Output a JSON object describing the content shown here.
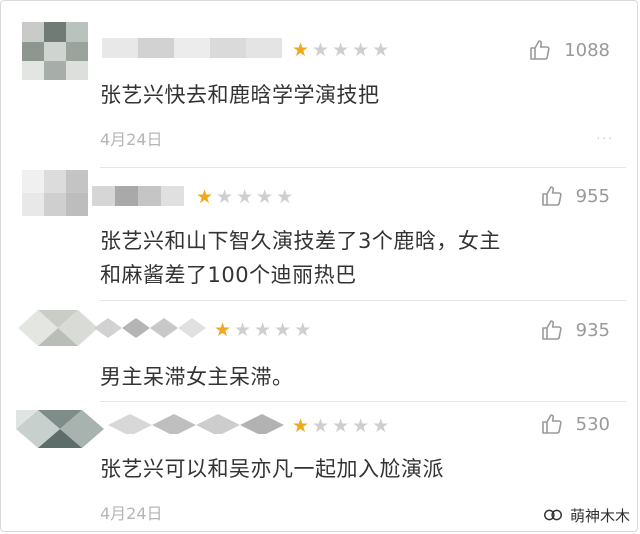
{
  "comments": [
    {
      "rating": 1,
      "likes": "1088",
      "text_lines": [
        "张艺兴快去和鹿晗学学演技把"
      ],
      "date": "4月24日"
    },
    {
      "rating": 1,
      "likes": "955",
      "text_lines": [
        "张艺兴和山下智久演技差了3个鹿晗，女主",
        "和麻酱差了100个迪丽热巴"
      ],
      "date": ""
    },
    {
      "rating": 1,
      "likes": "935",
      "text_lines": [
        "男主呆滞女主呆滞。"
      ],
      "date": ""
    },
    {
      "rating": 1,
      "likes": "530",
      "text_lines": [
        "张艺兴可以和吴亦凡一起加入尬演派"
      ],
      "date": "4月24日"
    }
  ],
  "more_glyph": "...",
  "watermark": {
    "text": "萌神木木",
    "icon": "wechat-channel-icon"
  },
  "colors": {
    "star_on": "#f0a91e",
    "star_off": "#cfcfcf",
    "meta": "#999999",
    "body_text": "#333333"
  }
}
